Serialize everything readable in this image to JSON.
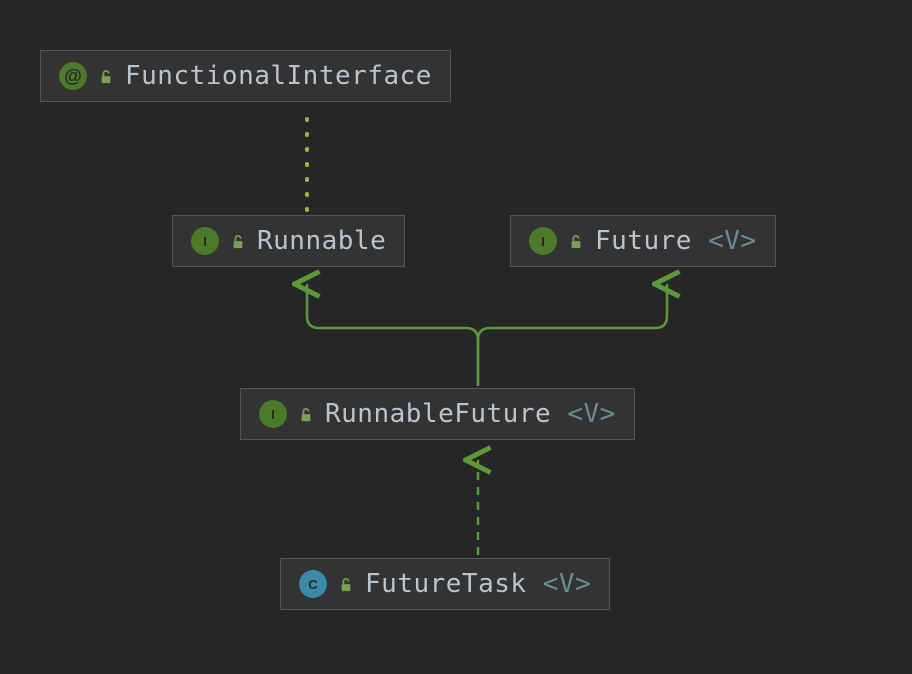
{
  "diagram": {
    "nodes": {
      "functionalInterface": {
        "kind": "annotation",
        "badge": "@",
        "label": "FunctionalInterface",
        "generic": ""
      },
      "runnable": {
        "kind": "interface",
        "badge": "I",
        "label": "Runnable",
        "generic": ""
      },
      "future": {
        "kind": "interface",
        "badge": "I",
        "label": "Future",
        "generic": "<V>"
      },
      "runnableFuture": {
        "kind": "interface",
        "badge": "I",
        "label": "RunnableFuture",
        "generic": "<V>"
      },
      "futureTask": {
        "kind": "class",
        "badge": "C",
        "label": "FutureTask",
        "generic": "<V>"
      }
    },
    "edges": [
      {
        "from": "runnable",
        "to": "functionalInterface",
        "style": "dotted"
      },
      {
        "from": "runnableFuture",
        "to": "runnable",
        "style": "solid"
      },
      {
        "from": "runnableFuture",
        "to": "future",
        "style": "solid"
      },
      {
        "from": "futureTask",
        "to": "runnableFuture",
        "style": "dashed"
      }
    ],
    "colors": {
      "edge": "#5a9a3a",
      "edgeDotted": "#aab030"
    }
  }
}
